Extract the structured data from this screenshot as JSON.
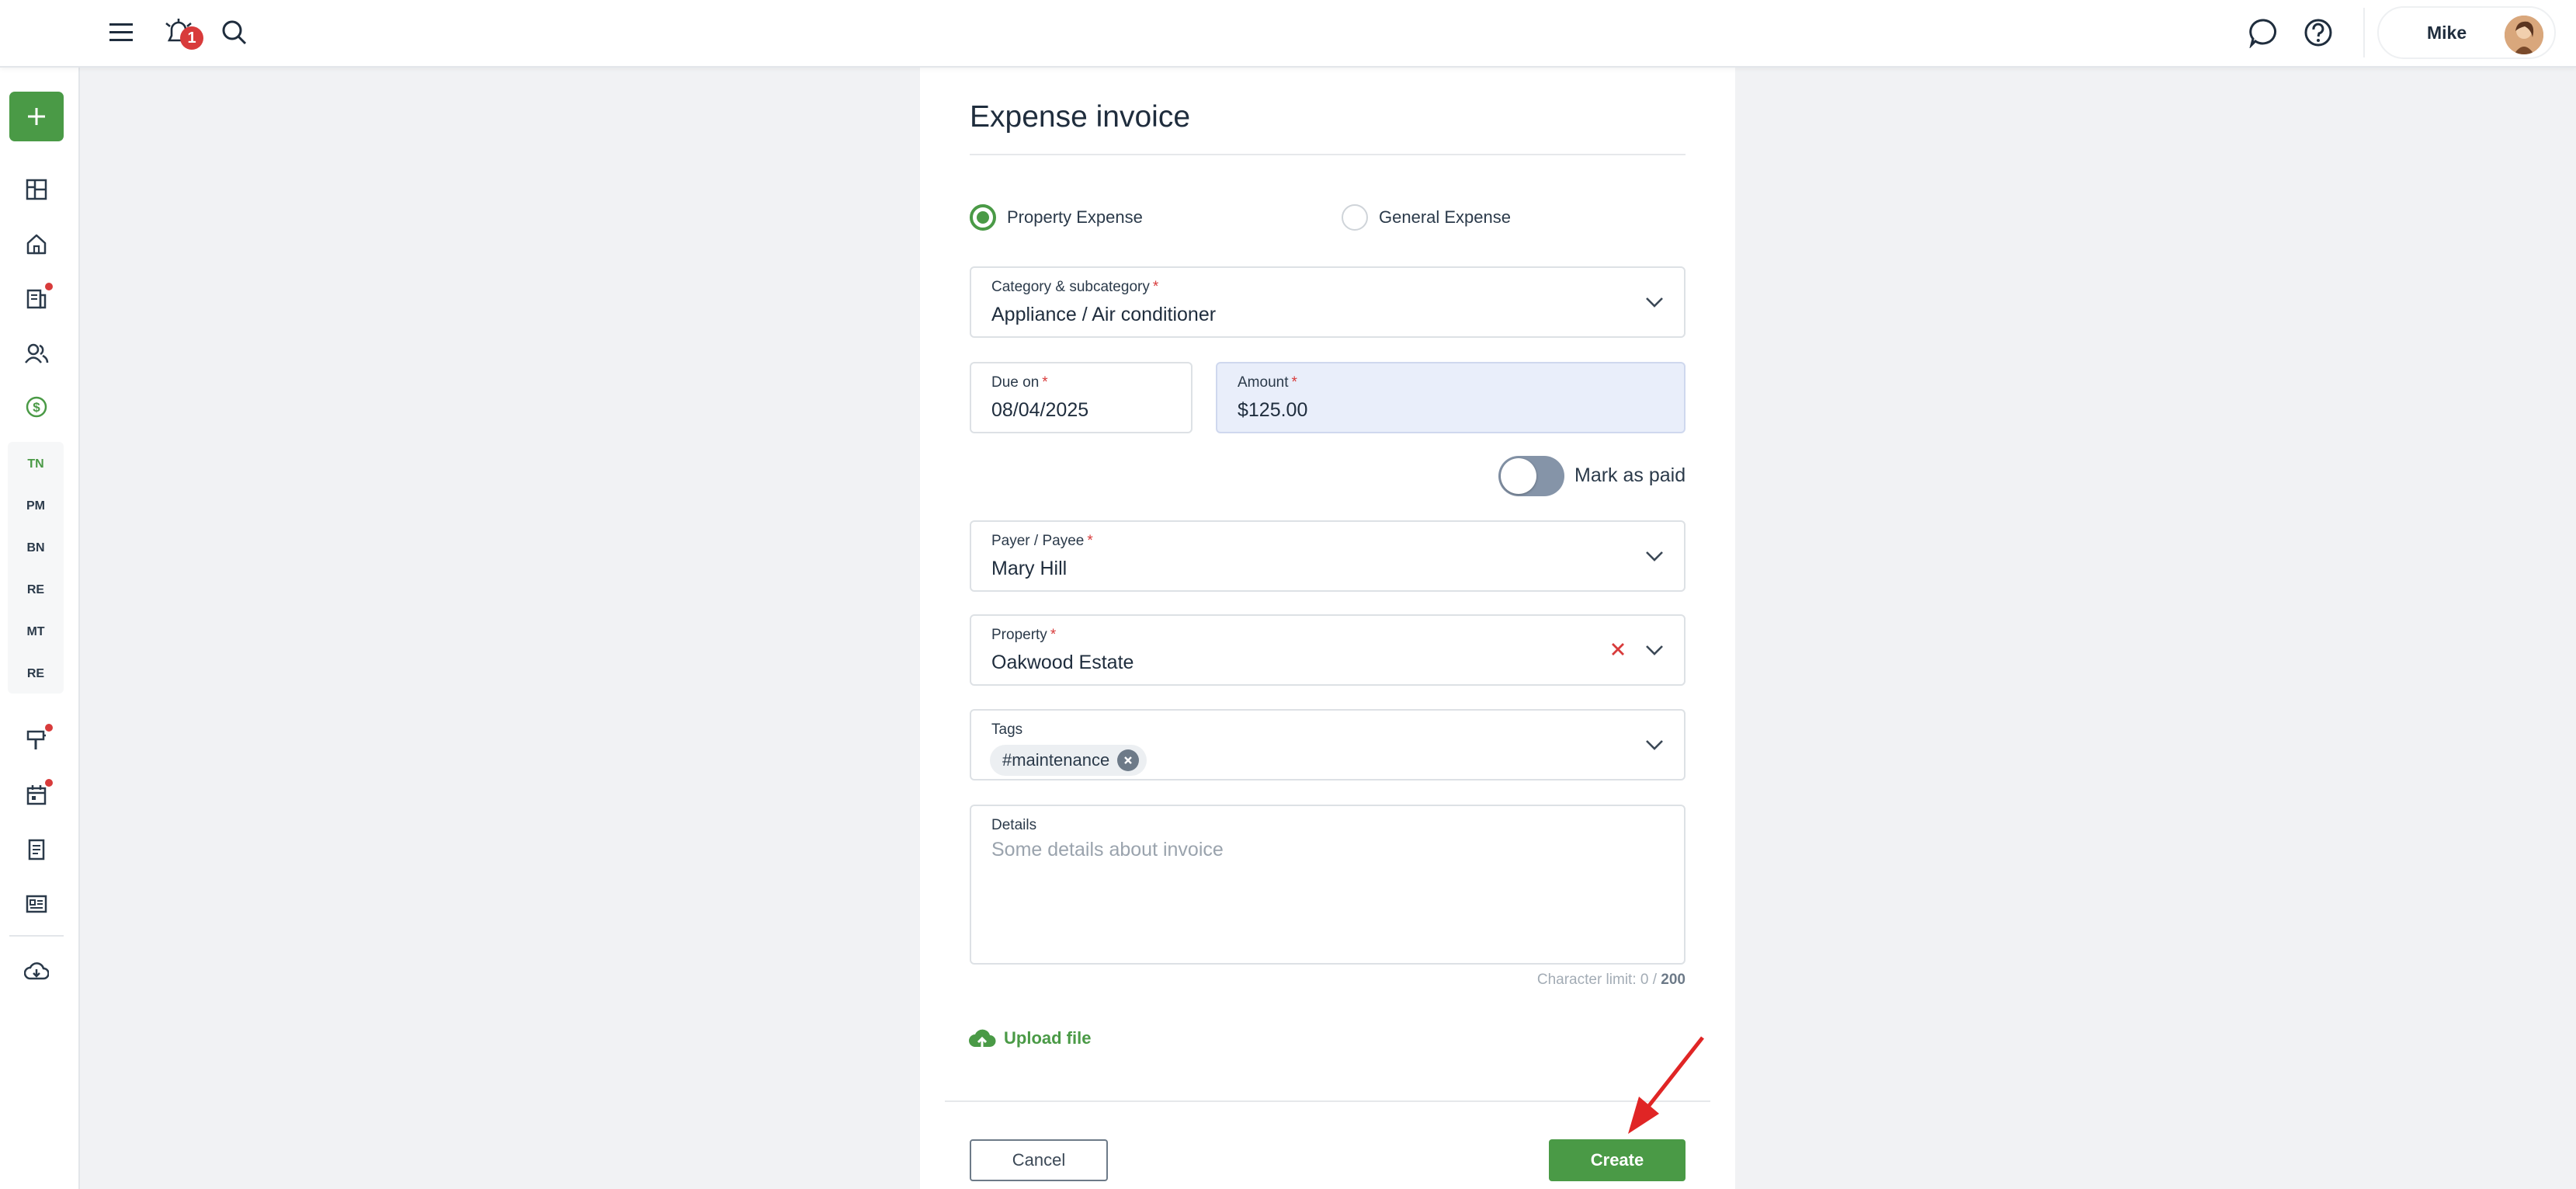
{
  "topbar": {
    "menu_icon": "hamburger-menu-icon",
    "notifications_count": "1",
    "user_name": "Mike"
  },
  "sidebar": {
    "add_label": "+",
    "sub_items": [
      "TN",
      "PM",
      "BN",
      "RE",
      "MT",
      "RE"
    ]
  },
  "form": {
    "title": "Expense invoice",
    "expense_type": {
      "options": [
        "Property Expense",
        "General Expense"
      ],
      "selected": "Property Expense"
    },
    "category": {
      "label": "Category & subcategory",
      "value": "Appliance / Air conditioner"
    },
    "due_on": {
      "label": "Due on",
      "value": "08/04/2025"
    },
    "amount": {
      "label": "Amount",
      "value": "$125.00"
    },
    "mark_as_paid": {
      "label": "Mark as paid",
      "checked": false
    },
    "payer": {
      "label": "Payer / Payee",
      "value": "Mary Hill"
    },
    "property": {
      "label": "Property",
      "value": "Oakwood Estate"
    },
    "tags": {
      "label": "Tags",
      "items": [
        "#maintenance"
      ]
    },
    "details": {
      "label": "Details",
      "placeholder": "Some details about invoice",
      "char_limit_text": "Character limit: 0 / ",
      "char_limit_max": "200"
    },
    "upload_label": "Upload file",
    "cancel_label": "Cancel",
    "create_label": "Create"
  },
  "colors": {
    "accent": "#4a9a46",
    "danger": "#d83b3b",
    "highlight_field": "#e9eefa"
  }
}
